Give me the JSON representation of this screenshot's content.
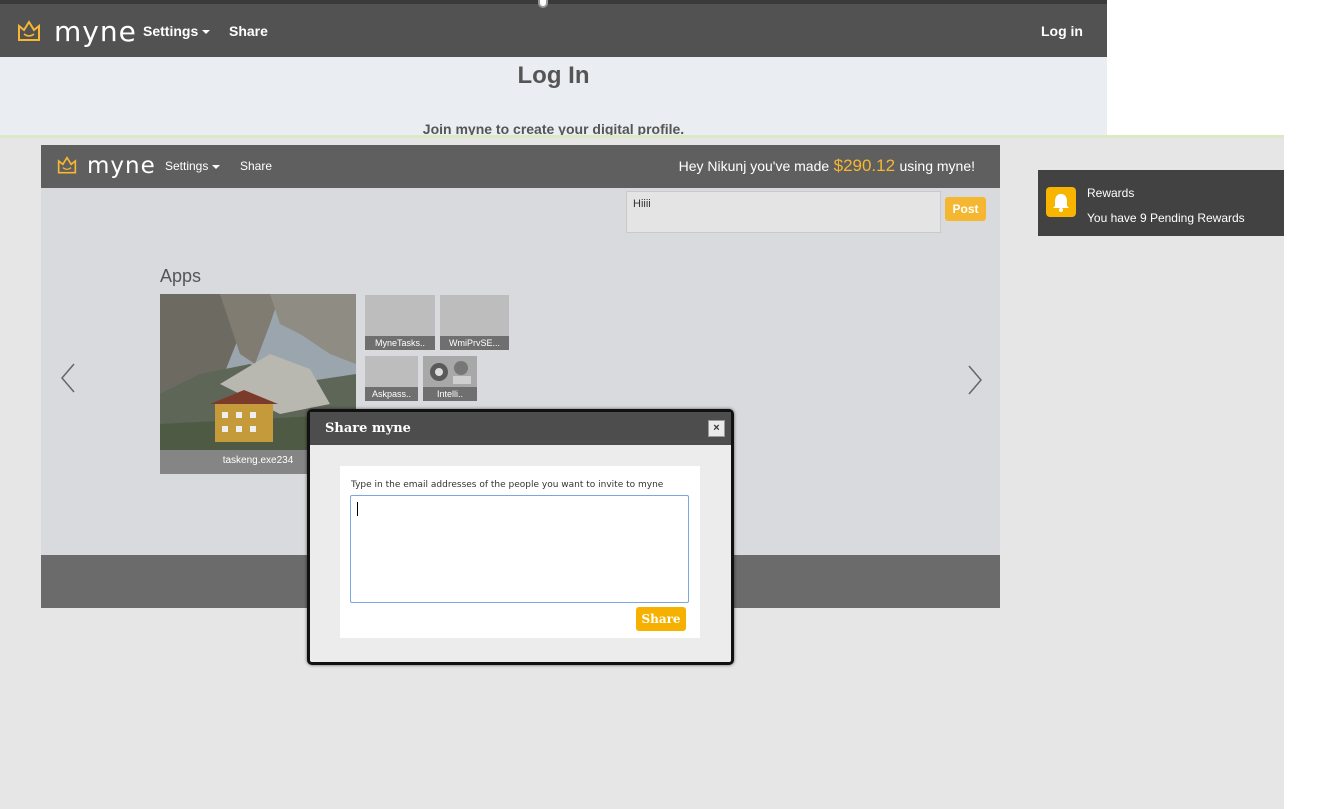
{
  "top_window": {
    "logo_text": "myne",
    "nav": {
      "settings": "Settings",
      "share": "Share",
      "login": "Log in"
    },
    "title": "Log In",
    "subtitle": "Join myne to create your digital profile."
  },
  "main_window": {
    "logo_text": "myne",
    "nav": {
      "settings": "Settings",
      "share": "Share"
    },
    "earnings": {
      "prefix": "Hey Nikunj you've made",
      "amount": "$290.12",
      "suffix": "using myne!"
    },
    "post": {
      "text": "Hiiii",
      "button": "Post"
    },
    "apps": {
      "heading": "Apps",
      "featured": {
        "caption": "taskeng.exe234"
      },
      "tiles": [
        {
          "caption": "MyneTasks.."
        },
        {
          "caption": "WmiPrvSE..."
        },
        {
          "caption": "Askpass.."
        },
        {
          "caption": "Intelli.."
        }
      ]
    }
  },
  "rewards": {
    "title": "Rewards",
    "message": "You have 9 Pending Rewards"
  },
  "share_dialog": {
    "title": "Share myne",
    "close": "×",
    "label": "Type in the email addresses of the people you want to invite to myne",
    "input_value": "",
    "button": "Share"
  },
  "colors": {
    "accent": "#f7b500",
    "nav": "#5f5f5f",
    "dialog_titlebar": "#4d4d4d"
  }
}
